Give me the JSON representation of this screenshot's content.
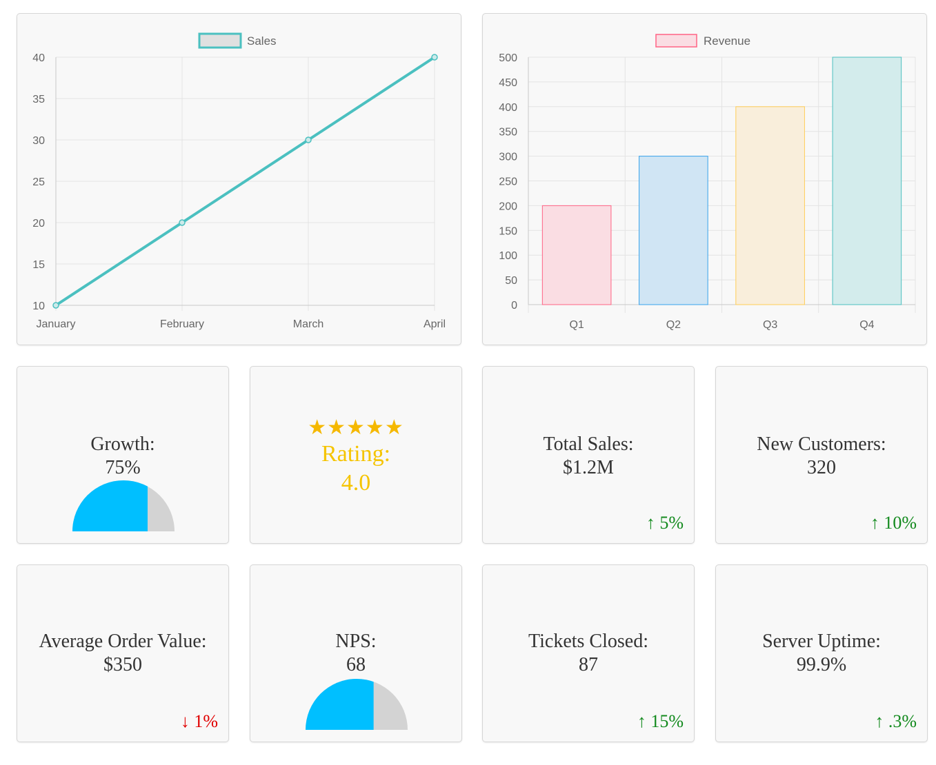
{
  "chart_data": [
    {
      "type": "line",
      "categories": [
        "January",
        "February",
        "March",
        "April"
      ],
      "series": [
        {
          "name": "Sales",
          "values": [
            10,
            20,
            30,
            40
          ]
        }
      ],
      "yticks": [
        "10",
        "15",
        "20",
        "25",
        "30",
        "35",
        "40"
      ],
      "ylim": [
        10,
        40
      ],
      "grid": true,
      "legend": "top-center",
      "color": "#4bc0c0"
    },
    {
      "type": "bar",
      "categories": [
        "Q1",
        "Q2",
        "Q3",
        "Q4"
      ],
      "series": [
        {
          "name": "Revenue",
          "values": [
            200,
            300,
            400,
            500
          ]
        }
      ],
      "yticks": [
        "0",
        "50",
        "100",
        "150",
        "200",
        "250",
        "300",
        "350",
        "400",
        "450",
        "500"
      ],
      "ylim": [
        0,
        500
      ],
      "grid": true,
      "legend": "top-center",
      "bar_colors": [
        {
          "fill": "#fadde3",
          "stroke": "#ff6384"
        },
        {
          "fill": "#d0e5f4",
          "stroke": "#36a2eb"
        },
        {
          "fill": "#f9eedb",
          "stroke": "#ffcd56"
        },
        {
          "fill": "#d3ecec",
          "stroke": "#4bc0c0"
        }
      ],
      "legend_colors": {
        "fill": "#fadde3",
        "stroke": "#ff6384"
      }
    }
  ],
  "kpis": {
    "growth": {
      "label": "Growth:",
      "value": "75%",
      "gauge_fraction": 0.75
    },
    "rating": {
      "stars": "★★★★★",
      "label": "Rating:",
      "value": "4.0"
    },
    "total_sales": {
      "label": "Total Sales:",
      "value": "$1.2M",
      "trend": "↑ 5%"
    },
    "new_customers": {
      "label": "New Customers:",
      "value": "320",
      "trend": "↑ 10%"
    },
    "avg_order": {
      "label": "Average Order Value:",
      "value": "$350",
      "trend": "↓ 1%"
    },
    "nps": {
      "label": "NPS:",
      "value": "68",
      "gauge_fraction": 0.68
    },
    "tickets": {
      "label": "Tickets Closed:",
      "value": "87",
      "trend": "↑ 15%"
    },
    "uptime": {
      "label": "Server Uptime:",
      "value": "99.9%",
      "trend": "↑ .3%"
    }
  },
  "colors": {
    "gauge_fill": "#00bfff",
    "gauge_track": "#d3d3d3",
    "trend_up": "#138a1e",
    "trend_down": "#e00000",
    "rating": "#f5c400"
  }
}
